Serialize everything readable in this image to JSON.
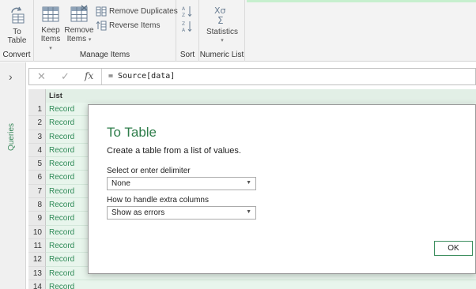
{
  "ribbon": {
    "convert": {
      "group_label": "Convert",
      "to_table_line1": "To",
      "to_table_line2": "Table"
    },
    "manage_items": {
      "group_label": "Manage Items",
      "keep_line1": "Keep",
      "keep_line2": "Items",
      "remove_line1": "Remove",
      "remove_line2": "Items",
      "remove_duplicates": "Remove Duplicates",
      "reverse_items": "Reverse Items"
    },
    "sort": {
      "group_label": "Sort"
    },
    "numeric_list": {
      "group_label": "Numeric List",
      "statistics": "Statistics"
    }
  },
  "queries_pane": {
    "label": "Queries"
  },
  "formula_bar": {
    "fx": "fx",
    "formula": "= Source[data]"
  },
  "grid": {
    "column_header": "List",
    "rows": [
      {
        "n": "1",
        "v": "Record"
      },
      {
        "n": "2",
        "v": "Record"
      },
      {
        "n": "3",
        "v": "Record"
      },
      {
        "n": "4",
        "v": "Record"
      },
      {
        "n": "5",
        "v": "Record"
      },
      {
        "n": "6",
        "v": "Record"
      },
      {
        "n": "7",
        "v": "Record"
      },
      {
        "n": "8",
        "v": "Record"
      },
      {
        "n": "9",
        "v": "Record"
      },
      {
        "n": "10",
        "v": "Record"
      },
      {
        "n": "11",
        "v": "Record"
      },
      {
        "n": "12",
        "v": "Record"
      },
      {
        "n": "13",
        "v": "Record"
      },
      {
        "n": "14",
        "v": "Record"
      }
    ]
  },
  "dialog": {
    "title": "To Table",
    "description": "Create a table from a list of values.",
    "delimiter_label": "Select or enter delimiter",
    "delimiter_value": "None",
    "extra_columns_label": "How to handle extra columns",
    "extra_columns_value": "Show as errors",
    "ok": "OK"
  },
  "colors": {
    "accent": "#2e7d4a",
    "grid_cell": "#e8f5ec",
    "record_text": "#2e8a57"
  }
}
